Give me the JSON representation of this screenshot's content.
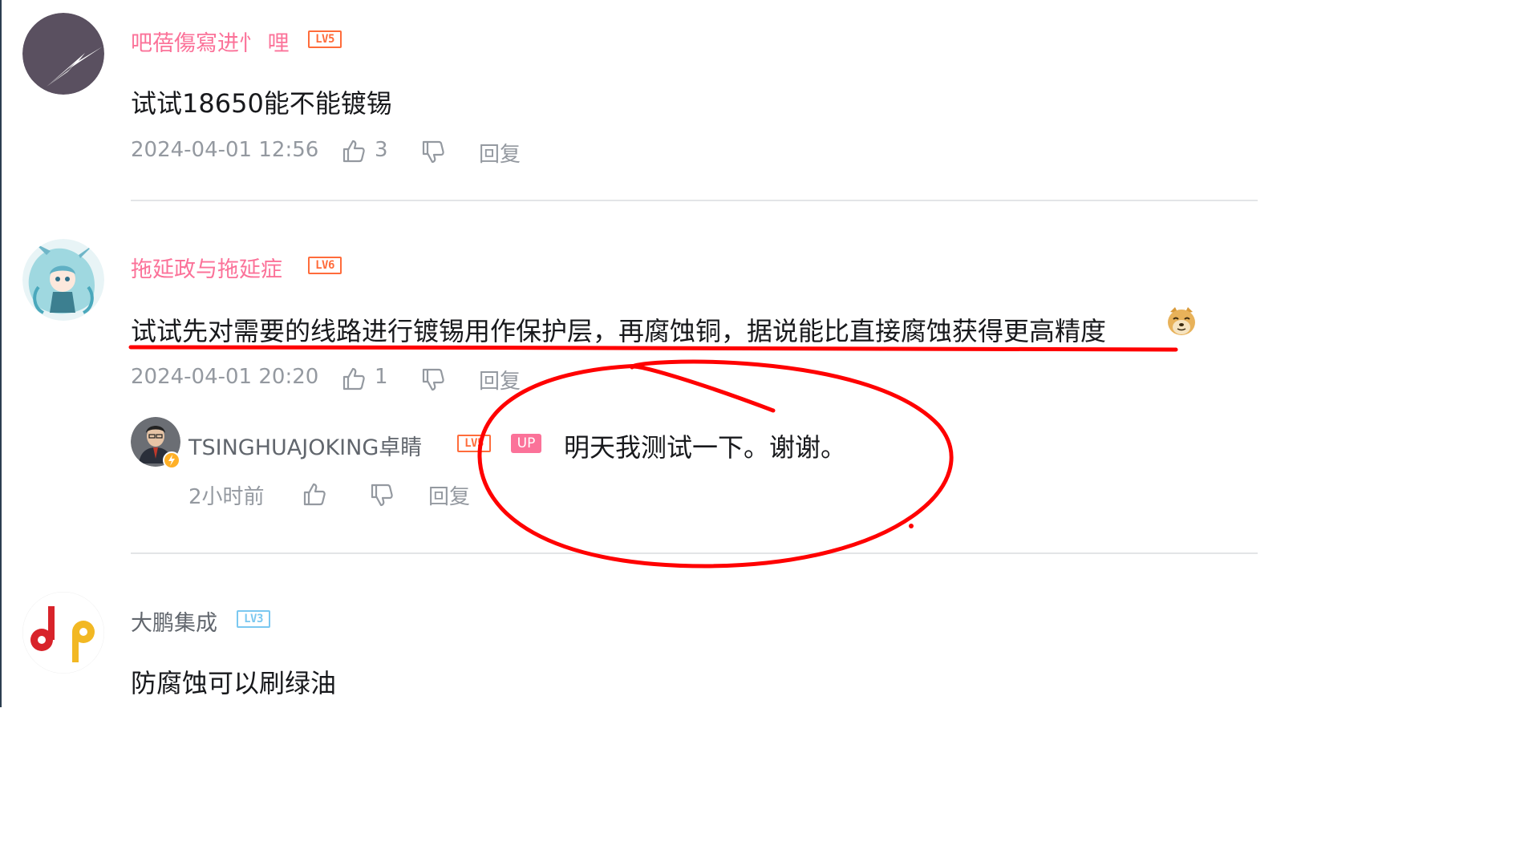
{
  "comments": [
    {
      "username": "吧蓓傷寫进忄 哩",
      "level": "LV5",
      "text": "试试18650能不能镀锡",
      "time": "2024-04-01 12:56",
      "likes": "3",
      "reply_label": "回复",
      "avatar_icon": "lightning-avatar-icon"
    },
    {
      "username": "拖延政与拖延症",
      "level": "LV6",
      "text": "试试先对需要的线路进行镀锡用作保护层，再腐蚀铜，据说能比直接腐蚀获得更高精度",
      "time": "2024-04-01 20:20",
      "likes": "1",
      "reply_label": "回复",
      "avatar_icon": "anime-character-avatar-icon",
      "emoji": "doge-emoji-icon",
      "reply": {
        "username": "TSINGHUAJOKING卓睛",
        "level": "LV5",
        "up_label": "UP",
        "text": "明天我测试一下。谢谢。",
        "time": "2小时前",
        "reply_label": "回复"
      }
    },
    {
      "username": "大鹏集成",
      "level": "LV3",
      "text": "防腐蚀可以刷绿油",
      "avatar_icon": "dp-logo-avatar-icon"
    }
  ],
  "colors": {
    "username_pink": "#fb7299",
    "level_orange": "#ff6c3b",
    "level_blue": "#7bc8f0",
    "meta_gray": "#9499a0",
    "annotation_red": "#ff0000"
  }
}
